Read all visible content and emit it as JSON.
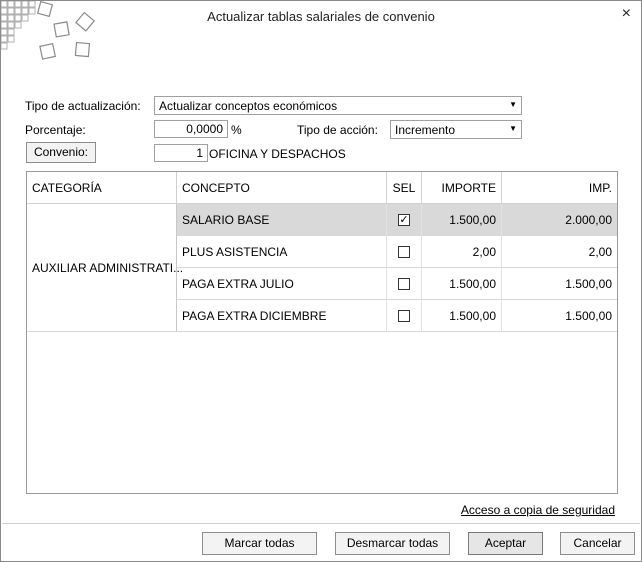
{
  "window": {
    "title": "Actualizar tablas salariales de convenio",
    "close_icon": "×"
  },
  "form": {
    "tipo_label": "Tipo de actualización:",
    "tipo_value": "Actualizar conceptos económicos",
    "porcentaje_label": "Porcentaje:",
    "porcentaje_value": "0,0000",
    "porcentaje_unit": "%",
    "accion_label": "Tipo de acción:",
    "accion_value": "Incremento",
    "convenio_button": "Convenio:",
    "convenio_value": "1",
    "convenio_name": "OFICINA Y DESPACHOS",
    "dropdown_arrow": "▼"
  },
  "grid": {
    "headers": {
      "categoria": "CATEGORÍA",
      "concepto": "CONCEPTO",
      "sel": "SEL",
      "importe": "IMPORTE",
      "imp_actualizado": "IMP. ACTUALIZADO"
    },
    "categoria": "AUXILIAR ADMINISTRATI...",
    "rows": [
      {
        "concepto": "SALARIO BASE",
        "checked": true,
        "importe": "1.500,00",
        "actualizado": "2.000,00"
      },
      {
        "concepto": "PLUS ASISTENCIA",
        "checked": false,
        "importe": "2,00",
        "actualizado": "2,00"
      },
      {
        "concepto": "PAGA EXTRA JULIO",
        "checked": false,
        "importe": "1.500,00",
        "actualizado": "1.500,00"
      },
      {
        "concepto": "PAGA EXTRA DICIEMBRE",
        "checked": false,
        "importe": "1.500,00",
        "actualizado": "1.500,00"
      }
    ],
    "check_mark": "✓"
  },
  "footer": {
    "backup_link": "Acceso a copia de seguridad",
    "marcar": "Marcar todas",
    "desmarcar": "Desmarcar todas",
    "aceptar": "Aceptar",
    "cancelar": "Cancelar"
  }
}
